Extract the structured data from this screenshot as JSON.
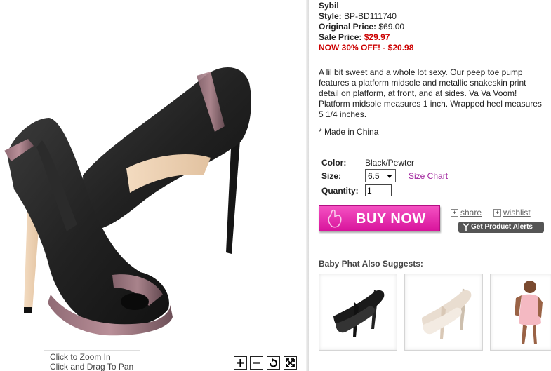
{
  "product": {
    "name": "Sybil",
    "style_label": "Style:",
    "style_value": "BP-BD111740",
    "original_label": "Original Price:",
    "original_value": "$69.00",
    "sale_label": "Sale Price:",
    "sale_value": "$29.97",
    "discount_text": "NOW 30% OFF! - $20.98",
    "description": "A lil bit sweet and a whole lot sexy. Our peep toe pump features a platform midsole and metallic snakeskin print detail on platform, at front, and at sides. Va Va Voom! Platform midsole measures 1 inch. Wrapped heel measures 5 1/4 inches.",
    "origin": "* Made in China"
  },
  "options": {
    "color_label": "Color:",
    "color_value": "Black/Pewter",
    "size_label": "Size:",
    "size_value": "6.5",
    "size_chart_link": "Size Chart",
    "quantity_label": "Quantity:",
    "quantity_value": "1"
  },
  "actions": {
    "buy_now": "BUY NOW",
    "share": "share",
    "wishlist": "wishlist",
    "product_alerts": "Get Product Alerts"
  },
  "viewer": {
    "zoom_hint_1": "Click to Zoom In",
    "zoom_hint_2": "Click and Drag To Pan",
    "controls": [
      "zoom-in-icon",
      "zoom-out-icon",
      "rotate-icon",
      "fullscreen-icon"
    ]
  },
  "suggestions": {
    "title": "Baby Phat Also Suggests:",
    "items": [
      "black-slingback-heel",
      "nude-slingback-heel",
      "pink-dress"
    ]
  },
  "colors": {
    "sale_red": "#cc0000",
    "link_purple": "#a0249c",
    "buy_pink": "#e01aa8"
  }
}
